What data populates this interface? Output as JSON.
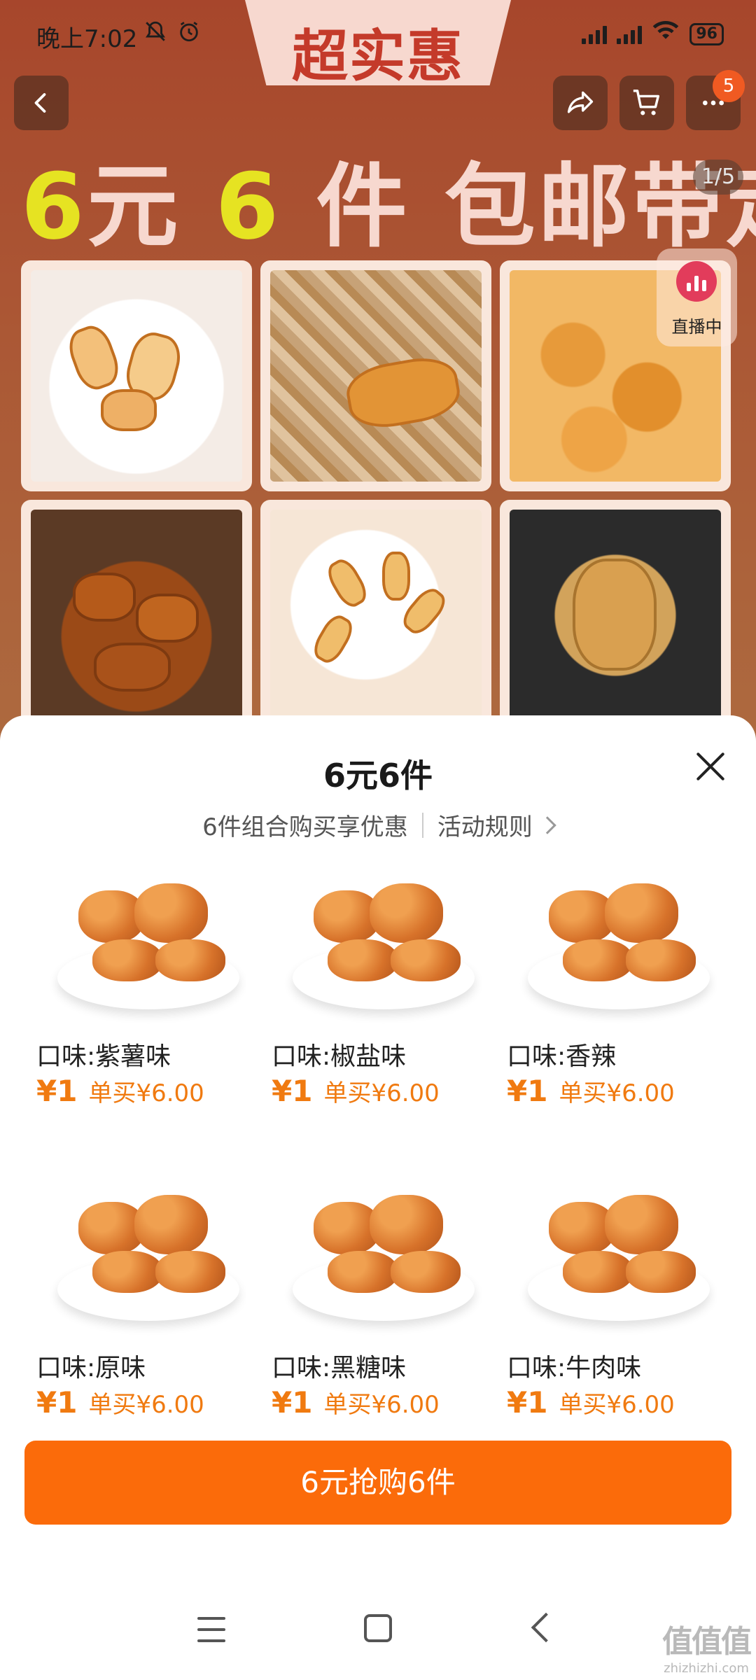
{
  "status_bar": {
    "time": "晚上7:02",
    "battery": "96",
    "icons": [
      "mute-icon",
      "alarm-icon",
      "hd-signal-icon",
      "signal-icon",
      "wifi-icon",
      "battery-icon"
    ]
  },
  "header": {
    "promo_tab": "超实惠",
    "cart_badge": "5",
    "icons": [
      "back-icon",
      "share-icon",
      "cart-icon",
      "more-icon"
    ]
  },
  "banner": {
    "headline_num1": "6",
    "headline_mid": "元",
    "headline_num2": "6",
    "headline_rest": "件 包邮带走",
    "image_counter": "1/5",
    "live_label": "直播中"
  },
  "sheet": {
    "title": "6元6件",
    "subtitle": "6件组合购买享优惠",
    "rules_link": "活动规则",
    "products": [
      {
        "flavor": "口味:紫薯味",
        "price": "¥1",
        "single_price": "单买¥6.00"
      },
      {
        "flavor": "口味:椒盐味",
        "price": "¥1",
        "single_price": "单买¥6.00"
      },
      {
        "flavor": "口味:香辣",
        "price": "¥1",
        "single_price": "单买¥6.00"
      },
      {
        "flavor": "口味:原味",
        "price": "¥1",
        "single_price": "单买¥6.00"
      },
      {
        "flavor": "口味:黑糖味",
        "price": "¥1",
        "single_price": "单买¥6.00"
      },
      {
        "flavor": "口味:牛肉味",
        "price": "¥1",
        "single_price": "单买¥6.00"
      }
    ],
    "buy_button": "6元抢购6件"
  },
  "watermark": {
    "logo": "值值值",
    "url": "zhizhizhi.com"
  },
  "colors": {
    "accent": "#fb6b0a",
    "price": "#f07a10",
    "banner": "#e8623d"
  }
}
